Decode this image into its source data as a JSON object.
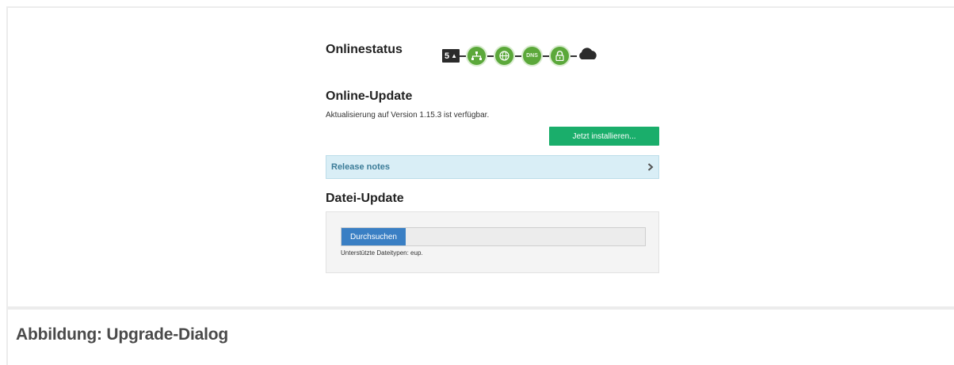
{
  "online_status": {
    "title": "Onlinestatus",
    "counter": "5",
    "nodes": [
      {
        "icon": "network-icon"
      },
      {
        "icon": "globe-icon"
      },
      {
        "icon": "dns-icon",
        "label": "DNS"
      },
      {
        "icon": "lock-icon"
      },
      {
        "icon": "cloud-icon"
      }
    ],
    "colors": {
      "node": "#5ba83a",
      "counter": "#2b2b2b"
    }
  },
  "online_update": {
    "title": "Online-Update",
    "message": "Aktualisierung auf Version 1.15.3 ist verfügbar.",
    "install_label": "Jetzt installieren...",
    "install_color": "#1aae6b"
  },
  "release_notes": {
    "label": "Release notes",
    "chevron": "›"
  },
  "file_update": {
    "title": "Datei-Update",
    "browse_label": "Durchsuchen",
    "hint": "Unterstützte Dateitypen: eup.",
    "browse_color": "#3a7fc4"
  },
  "caption": "Abbildung: Upgrade-Dialog"
}
